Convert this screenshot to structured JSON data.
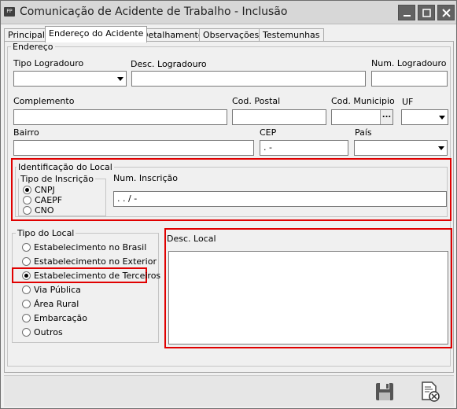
{
  "window": {
    "title": "Comunicação de Acidente de Trabalho - Inclusão",
    "app_icon_text": "PP"
  },
  "tabs": [
    "Principal",
    "Endereço do Acidente",
    "Detalhamento",
    "Observações",
    "Testemunhas"
  ],
  "active_tab": "Endereço do Acidente",
  "endereco": {
    "legend": "Endereço",
    "tipo_logradouro": {
      "label": "Tipo Logradouro",
      "value": ""
    },
    "desc_logradouro": {
      "label": "Desc. Logradouro",
      "value": ""
    },
    "num_logradouro": {
      "label": "Num. Logradouro",
      "value": ""
    },
    "complemento": {
      "label": "Complemento",
      "value": ""
    },
    "cod_postal": {
      "label": "Cod. Postal",
      "value": ""
    },
    "cod_municipio": {
      "label": "Cod. Municipio",
      "value": "",
      "button": "..."
    },
    "uf": {
      "label": "UF",
      "value": ""
    },
    "bairro": {
      "label": "Bairro",
      "value": ""
    },
    "cep": {
      "label": "CEP",
      "value": " .  -"
    },
    "pais": {
      "label": "País",
      "value": ""
    }
  },
  "identificacao": {
    "legend": "Identificação do Local",
    "tipo_inscricao": {
      "legend": "Tipo de Inscrição",
      "options": [
        "CNPJ",
        "CAEPF",
        "CNO"
      ],
      "selected": "CNPJ"
    },
    "num_inscricao": {
      "label": "Num. Inscrição",
      "value": " .  .  /  -"
    }
  },
  "tipo_local": {
    "legend": "Tipo do Local",
    "options": [
      "Estabelecimento no Brasil",
      "Estabelecimento no Exterior",
      "Estabelecimento de Terceiros",
      "Via Pública",
      "Área Rural",
      "Embarcação",
      "Outros"
    ],
    "selected": "Estabelecimento de Terceiros"
  },
  "desc_local": {
    "label": "Desc. Local",
    "value": ""
  },
  "toolbar": {
    "save": "save-icon",
    "cancel": "cancel-document-icon"
  },
  "colors": {
    "highlight": "#e00000",
    "titlebar": "#d7d7d7"
  }
}
